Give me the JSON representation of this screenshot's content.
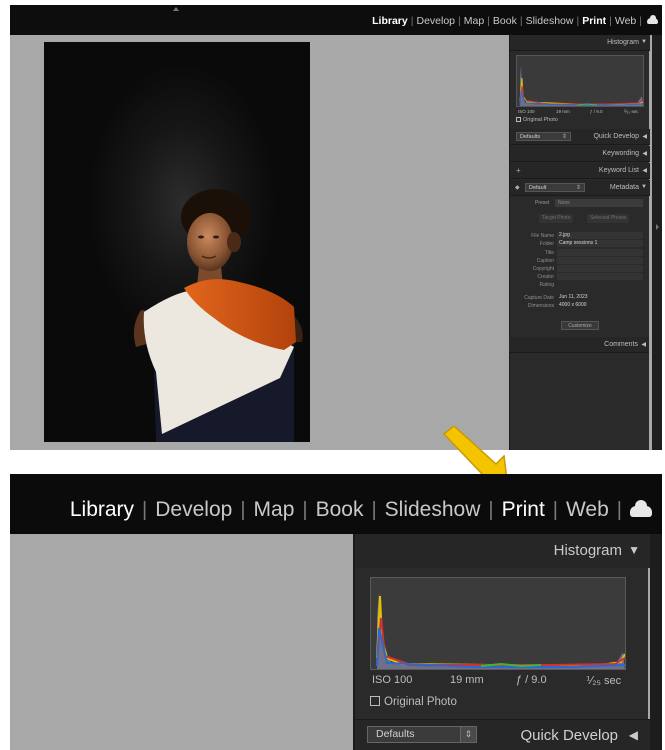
{
  "modules": {
    "items": [
      "Library",
      "Develop",
      "Map",
      "Book",
      "Slideshow",
      "Print",
      "Web"
    ],
    "separator": "|"
  },
  "histogram": {
    "title": "Histogram",
    "iso": "ISO 100",
    "focal": "19 mm",
    "aperture": "ƒ / 9.0",
    "shutter": "⅟₂₅ sec",
    "shutter_small": "⅟₂₅ sec",
    "original_photo": "Original Photo"
  },
  "quick_develop": {
    "title": "Quick Develop",
    "preset": "Defaults"
  },
  "keywording": {
    "title": "Keywording"
  },
  "keyword_list": {
    "title": "Keyword List",
    "add": "+"
  },
  "metadata": {
    "title": "Metadata",
    "view_preset": "Default",
    "preset_label": "Preset",
    "preset_value": "None",
    "target_photo": "Target Photo",
    "selected_photos": "Selected Photos",
    "fields": [
      {
        "label": "File Name",
        "value": "2.jpg"
      },
      {
        "label": "Folder",
        "value": "Camp sessions 1"
      },
      {
        "label": "Title",
        "value": ""
      },
      {
        "label": "Caption",
        "value": ""
      },
      {
        "label": "Copyright",
        "value": ""
      },
      {
        "label": "Creator",
        "value": ""
      },
      {
        "label": "Rating",
        "value": ""
      },
      {
        "label": "Capture Date",
        "value": "Jun 11, 2023"
      },
      {
        "label": "Dimensions",
        "value": "4000 x 6000"
      }
    ],
    "customize": "Customize"
  },
  "comments": {
    "title": "Comments"
  },
  "photo": {
    "subject": "boy-portrait"
  },
  "colors": {
    "topbar": "#0d0d0d",
    "panel": "#2a2a2a",
    "canvas": "#a8a8a8",
    "annotation_arrow": "#f5c400"
  }
}
